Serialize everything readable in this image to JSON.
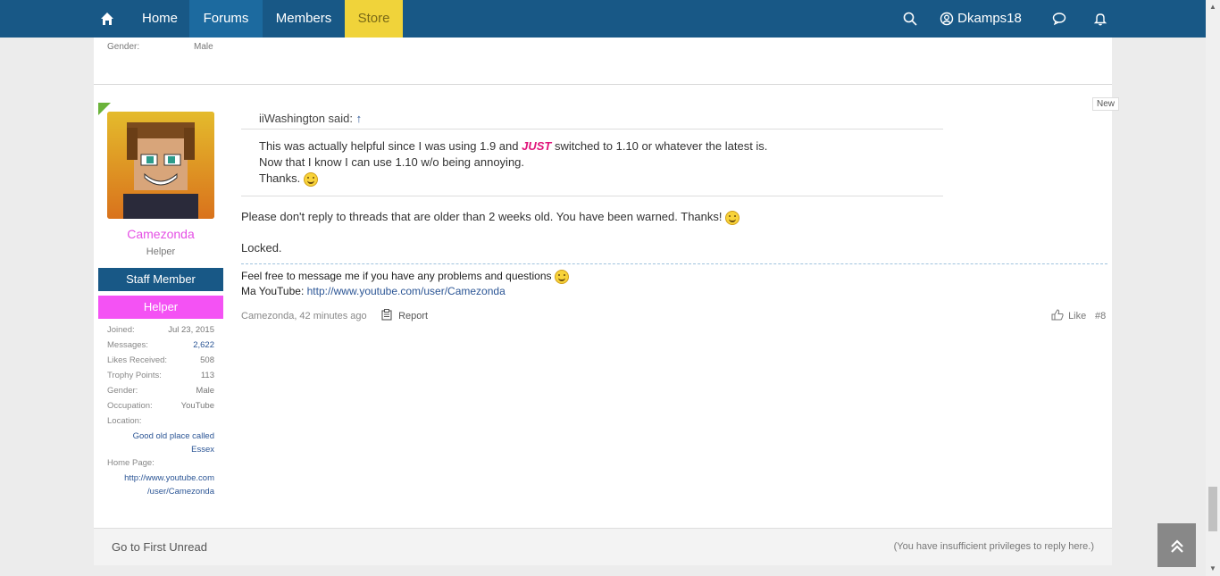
{
  "nav": {
    "home": "Home",
    "forums": "Forums",
    "members": "Members",
    "store": "Store",
    "username": "Dkamps18"
  },
  "previous_post": {
    "gender_label": "Gender:",
    "gender_value": "Male"
  },
  "post": {
    "new_badge": "New",
    "author": "Camezonda",
    "author_title": "Helper",
    "banner_staff": "Staff Member",
    "banner_helper": "Helper",
    "stats": {
      "joined_label": "Joined:",
      "joined_value": "Jul 23, 2015",
      "messages_label": "Messages:",
      "messages_value": "2,622",
      "likes_label": "Likes Received:",
      "likes_value": "508",
      "trophy_label": "Trophy Points:",
      "trophy_value": "113",
      "gender_label": "Gender:",
      "gender_value": "Male",
      "occupation_label": "Occupation:",
      "occupation_value": "YouTube",
      "location_label": "Location:",
      "location_value_1": "Good old place called",
      "location_value_2": "Essex",
      "homepage_label": "Home Page:",
      "homepage_value_1": "http://www.youtube.com",
      "homepage_value_2": "/user/Camezonda"
    },
    "quote": {
      "author": "iiWashington said:",
      "arrow": "↑",
      "line1_pre": "This was actually helpful since I was using 1.9 and ",
      "line1_em": "JUST",
      "line1_post": " switched to 1.10 or whatever the latest is.",
      "line2": "Now that I know I can use 1.10 w/o being annoying.",
      "line3": "Thanks."
    },
    "message": "Please don't reply to threads that are older than 2 weeks old. You have been warned. Thanks!",
    "locked": "Locked.",
    "signature": {
      "line1": "Feel free to message me if you have any problems and questions",
      "line2_label": "Ma YouTube: ",
      "line2_link": "http://www.youtube.com/user/Camezonda"
    },
    "meta": "Camezonda, 42 minutes ago",
    "report": "Report",
    "like": "Like",
    "number": "#8"
  },
  "footer": {
    "first_unread": "Go to First Unread",
    "privileges": "(You have insufficient privileges to reply here.)"
  },
  "colors": {
    "nav_bg": "#185886",
    "store_bg": "#f0d33a",
    "username": "#e54fe5",
    "link": "#2b5595"
  }
}
